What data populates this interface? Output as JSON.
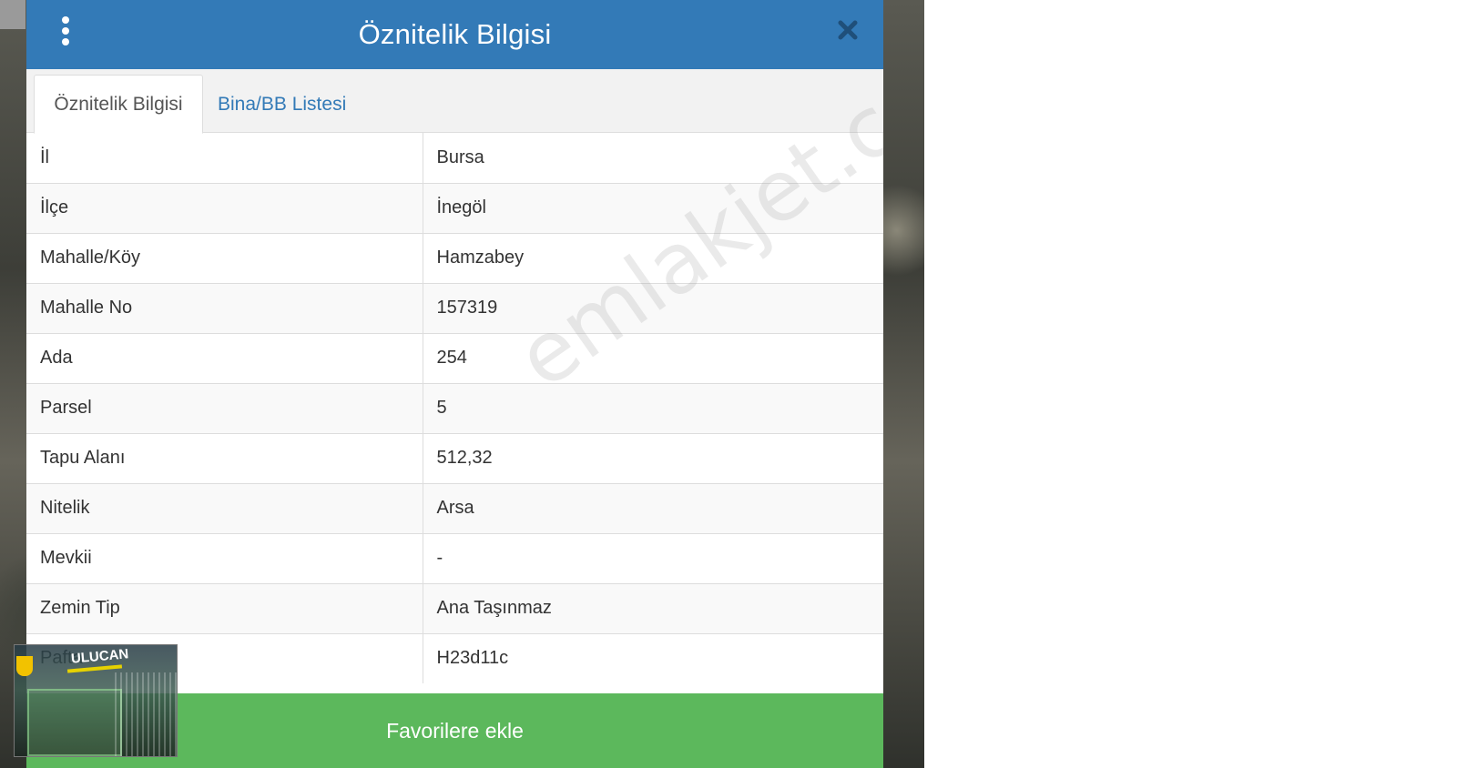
{
  "header": {
    "title": "Öznitelik Bilgisi"
  },
  "tabs": [
    {
      "label": "Öznitelik Bilgisi",
      "active": true
    },
    {
      "label": "Bina/BB Listesi",
      "active": false
    }
  ],
  "attributes": [
    {
      "key": "İl",
      "value": "Bursa"
    },
    {
      "key": "İlçe",
      "value": "İnegöl"
    },
    {
      "key": "Mahalle/Köy",
      "value": "Hamzabey"
    },
    {
      "key": "Mahalle No",
      "value": "157319"
    },
    {
      "key": "Ada",
      "value": "254"
    },
    {
      "key": "Parsel",
      "value": "5"
    },
    {
      "key": "Tapu Alanı",
      "value": "512,32"
    },
    {
      "key": "Nitelik",
      "value": "Arsa"
    },
    {
      "key": "Mevkii",
      "value": "-"
    },
    {
      "key": "Zemin Tip",
      "value": "Ana Taşınmaz"
    },
    {
      "key": "Pafta",
      "value": "H23d11c"
    }
  ],
  "footer": {
    "favorite_label": "Favorilere ekle"
  },
  "watermark": {
    "text": "emlakjet.com"
  },
  "logo": {
    "text": "ULUCAN"
  },
  "icons": {
    "menu": "vertical-dots-icon",
    "close": "close-icon"
  },
  "colors": {
    "header": "#337ab7",
    "tab_link": "#337ab7",
    "favorite_button": "#5cb85c"
  }
}
